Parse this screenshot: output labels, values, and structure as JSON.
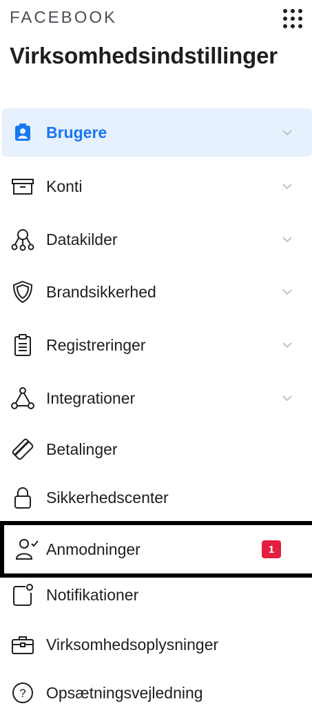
{
  "header": {
    "brand": "FACEBOOK",
    "title": "Virksomhedsindstillinger"
  },
  "nav": {
    "items": [
      {
        "label": "Brugere",
        "icon": "users-badge-icon",
        "active": true,
        "expandable": true
      },
      {
        "label": "Konti",
        "icon": "archive-box-icon",
        "expandable": true
      },
      {
        "label": "Datakilder",
        "icon": "data-sources-icon",
        "expandable": true
      },
      {
        "label": "Brandsikkerhed",
        "icon": "shield-icon",
        "expandable": true
      },
      {
        "label": "Registreringer",
        "icon": "clipboard-icon",
        "expandable": true
      },
      {
        "label": "Integrationer",
        "icon": "integration-icon",
        "expandable": true
      },
      {
        "label": "Betalinger",
        "icon": "credit-card-icon"
      },
      {
        "label": "Sikkerhedscenter",
        "icon": "lock-icon"
      },
      {
        "label": "Anmodninger",
        "icon": "user-check-icon",
        "badge": "1",
        "highlighted": true
      },
      {
        "label": "Notifikationer",
        "icon": "notification-icon"
      },
      {
        "label": "Virksomhedsoplysninger",
        "icon": "briefcase-icon"
      },
      {
        "label": "Opsætningsvejledning",
        "icon": "help-circle-icon"
      }
    ]
  },
  "colors": {
    "accent": "#1877f2",
    "active_bg": "#e7f0fd",
    "badge": "#e41e3f",
    "chevron": "#bec3c9"
  }
}
